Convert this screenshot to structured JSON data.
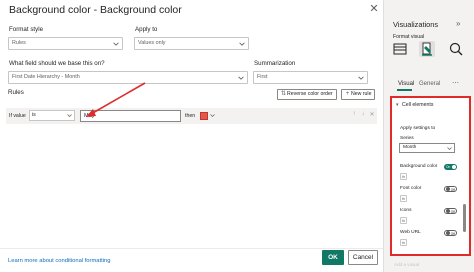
{
  "dialog": {
    "title": "Background color - Background color",
    "close_icon": "close-icon",
    "format_style": {
      "label": "Format style",
      "value": "Rules"
    },
    "apply_to": {
      "label": "Apply to",
      "value": "Values only"
    },
    "based_on": {
      "label": "What field should we base this on?",
      "value": "First Date Hierarchy - Month"
    },
    "summarization": {
      "label": "Summarization",
      "value": "First"
    },
    "rules_label": "Rules",
    "reverse_button": "Reverse color order",
    "new_rule_button": "New rule",
    "rule": {
      "if_value": "If value",
      "operator": "is",
      "value": "May",
      "then": "then",
      "color": "#e3584e"
    },
    "learn_link": "Learn more about conditional formatting",
    "ok_button": "OK",
    "cancel_button": "Cancel"
  },
  "visualizations": {
    "title": "Visualizations",
    "subtitle": "Format visual",
    "tabs": [
      "Visual",
      "General"
    ],
    "active_tab": "Visual",
    "section": "Cell elements",
    "apply_settings": "Apply settings to",
    "series_label": "Series",
    "series_value": "Month",
    "settings": [
      {
        "label": "Background color",
        "state": "On"
      },
      {
        "label": "Font color",
        "state": "Off"
      },
      {
        "label": "Icons",
        "state": "Off"
      },
      {
        "label": "Web URL",
        "state": "Off"
      }
    ],
    "footer_faded": "Add a visual",
    "accent": "#117865",
    "highlight": "#e02b2b"
  }
}
